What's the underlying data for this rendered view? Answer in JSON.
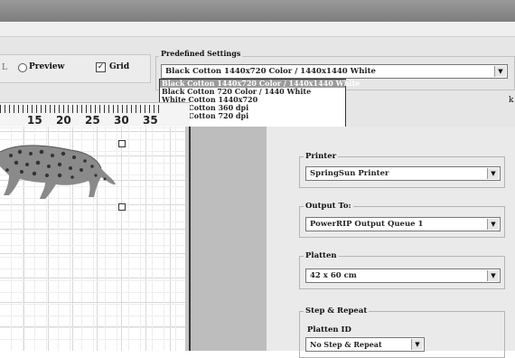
{
  "toolbar": {
    "fragment_left": "L",
    "preview_label": "Preview",
    "grid_label": "Grid",
    "grid_checked": true,
    "check_mark": "✓"
  },
  "predefined": {
    "label": "Predefined Settings",
    "selected": "Black Cotton 1440x720 Color / 1440x1440 White",
    "options": [
      "Black Cotton 1440x720 Color / 1440x1440 White",
      "Black Cotton 720 Color / 1440 White",
      "White Cotton 1440x720",
      "White Cotton 360 dpi",
      "White Cotton 720 dpi"
    ],
    "highlighted_index": 0,
    "arrow_icon": "▼"
  },
  "k_fragment": "k",
  "ruler": {
    "labels": [
      "15",
      "20",
      "25",
      "30",
      "35"
    ]
  },
  "canvas": {
    "image": "leopard-illustration"
  },
  "printer": {
    "label": "Printer",
    "value": "SpringSun Printer"
  },
  "output": {
    "label": "Output To:",
    "value": "PowerRIP Output Queue 1"
  },
  "platten": {
    "label": "Platten",
    "value": "42 x 60 cm"
  },
  "step_repeat": {
    "label": "Step & Repeat",
    "platten_id_label": "Platten ID",
    "value": "No Step & Repeat"
  }
}
